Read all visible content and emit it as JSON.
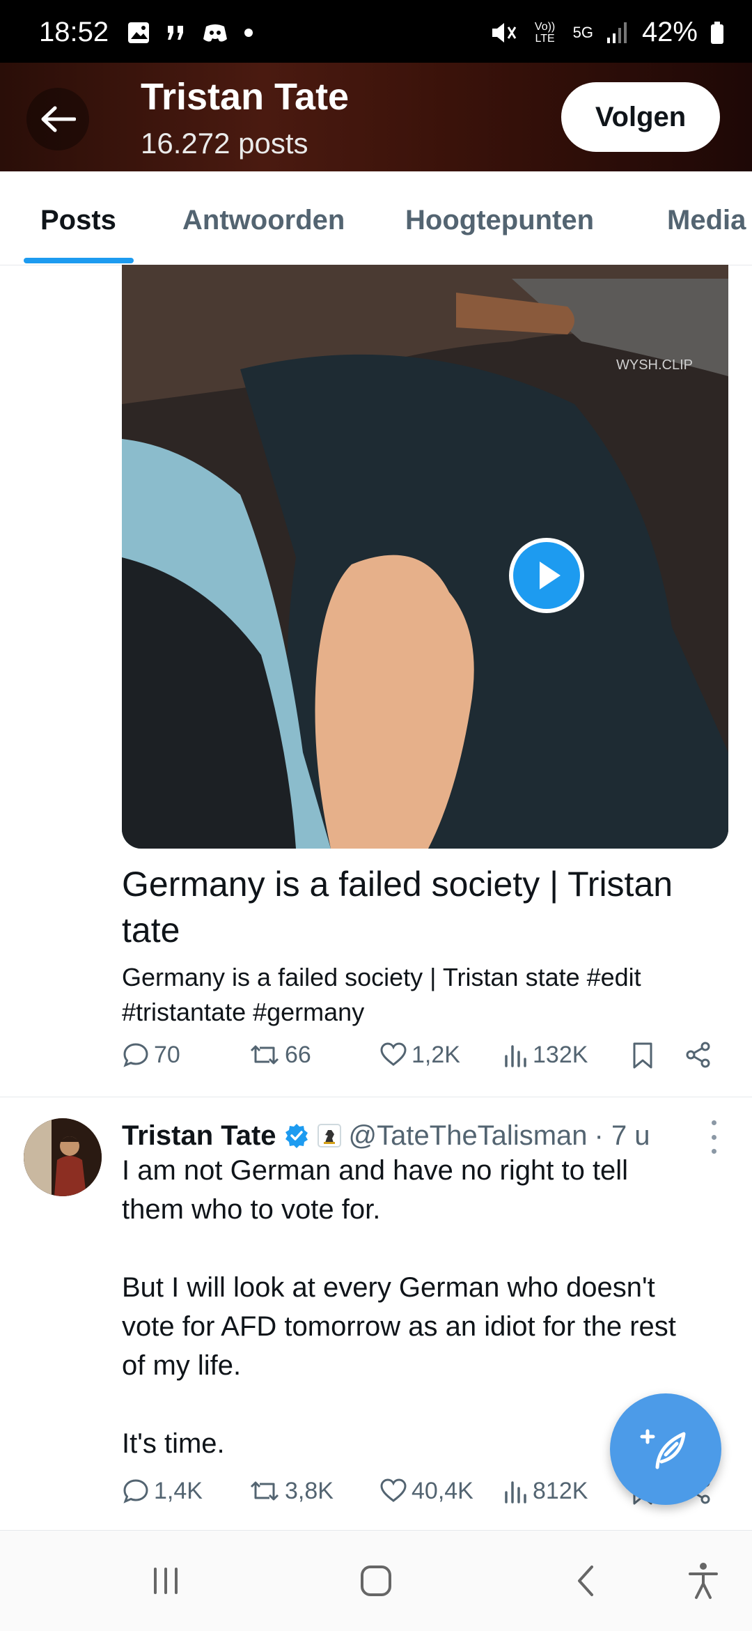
{
  "status_bar": {
    "time": "18:52",
    "volte": "Vo)) LTE",
    "network": "5G",
    "battery": "42%"
  },
  "header": {
    "name": "Tristan Tate",
    "post_count": "16.272 posts",
    "follow_label": "Volgen"
  },
  "tabs": [
    "Posts",
    "Antwoorden",
    "Hoogtepunten",
    "Media"
  ],
  "card": {
    "video_watermark": "WYSH.CLIP",
    "title": "Germany is a failed society | Tristan tate",
    "desc_line1": "Germany is a failed society | Tristan state #edit",
    "desc_line2": "#tristantate #germany",
    "stats": {
      "replies": "70",
      "reposts": "66",
      "likes": "1,2K",
      "views": "132K"
    }
  },
  "tweet": {
    "name": "Tristan Tate",
    "handle": "@TateTheTalisman",
    "time": "· 7 u",
    "lines": [
      "I am not German and have no right to tell",
      "them who to vote for.",
      "But I will look at every German who doesn't",
      "vote for AFD tomorrow as an idiot for the rest",
      "of my life.",
      "It's time."
    ],
    "stats": {
      "replies": "1,4K",
      "reposts": "3,8K",
      "likes": "40,4K",
      "views": "812K"
    }
  },
  "colors": {
    "accent": "#1d9bf0",
    "fab": "#4c9be8",
    "muted": "#536471"
  }
}
